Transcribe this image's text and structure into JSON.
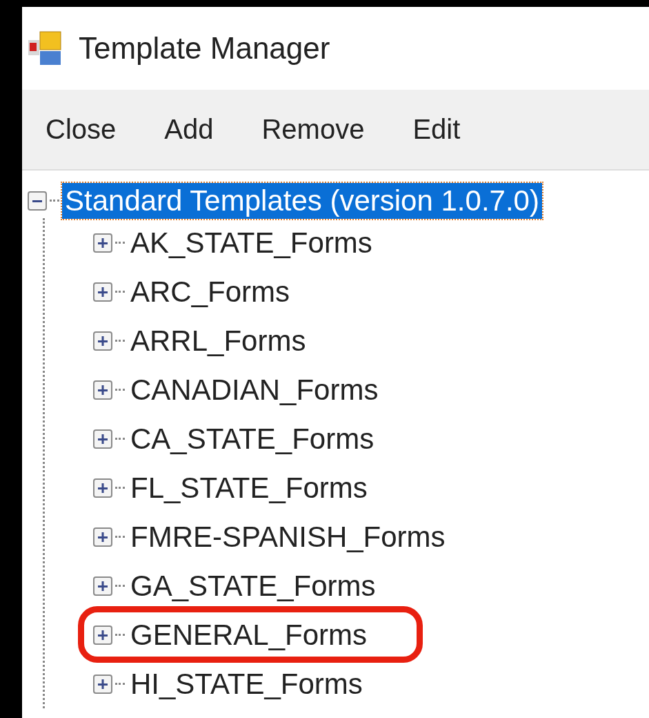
{
  "window": {
    "title": "Template Manager"
  },
  "menu": [
    "Close",
    "Add",
    "Remove",
    "Edit"
  ],
  "tree": [
    {
      "label": "Standard Templates (version 1.0.7.0)",
      "expanded": true,
      "selected": true,
      "highlighted": false,
      "children": [
        {
          "label": "AK_STATE_Forms",
          "expanded": false,
          "selected": false,
          "highlighted": false
        },
        {
          "label": "ARC_Forms",
          "expanded": false,
          "selected": false,
          "highlighted": false
        },
        {
          "label": "ARRL_Forms",
          "expanded": false,
          "selected": false,
          "highlighted": false
        },
        {
          "label": "CANADIAN_Forms",
          "expanded": false,
          "selected": false,
          "highlighted": false
        },
        {
          "label": "CA_STATE_Forms",
          "expanded": false,
          "selected": false,
          "highlighted": false
        },
        {
          "label": "FL_STATE_Forms",
          "expanded": false,
          "selected": false,
          "highlighted": false
        },
        {
          "label": "FMRE-SPANISH_Forms",
          "expanded": false,
          "selected": false,
          "highlighted": false
        },
        {
          "label": "GA_STATE_Forms",
          "expanded": false,
          "selected": false,
          "highlighted": false
        },
        {
          "label": "GENERAL_Forms",
          "expanded": false,
          "selected": false,
          "highlighted": true
        },
        {
          "label": "HI_STATE_Forms",
          "expanded": false,
          "selected": false,
          "highlighted": false
        }
      ]
    }
  ]
}
